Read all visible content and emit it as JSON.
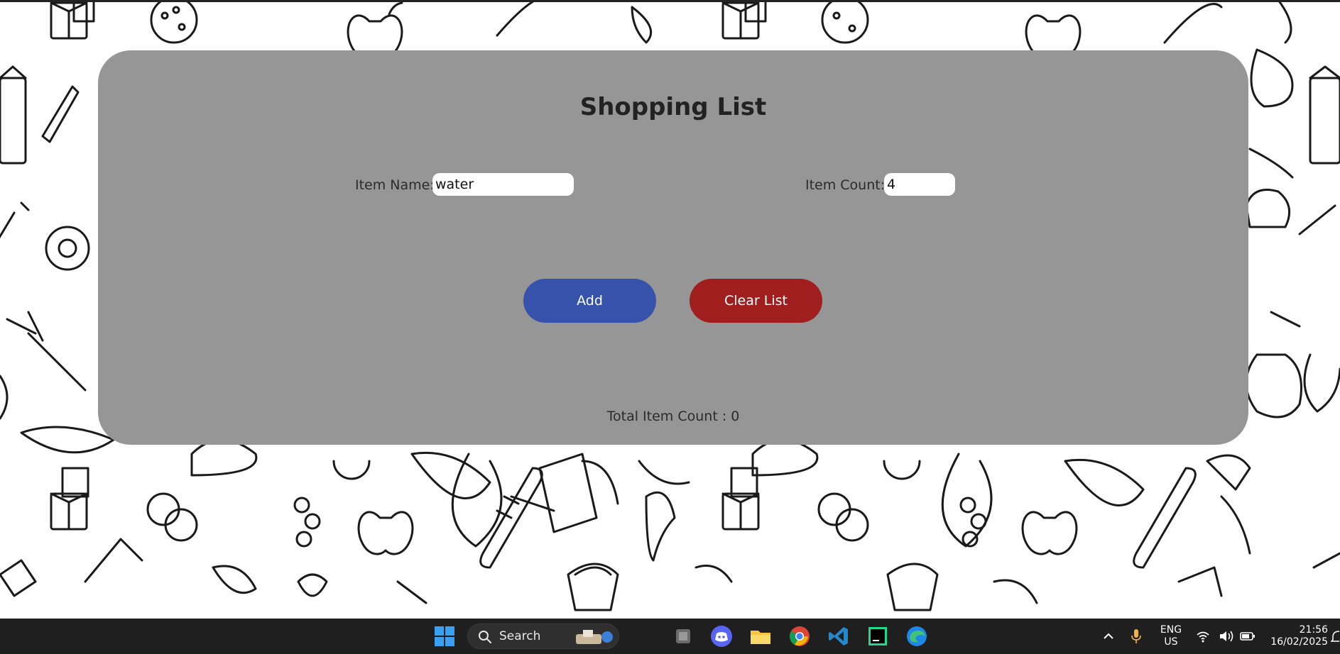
{
  "panel": {
    "title": "Shopping List",
    "item_name_label": "Item Name:",
    "item_name_value": "water",
    "item_count_label": "Item Count:",
    "item_count_value": "4",
    "add_label": "Add",
    "clear_label": "Clear List",
    "total_text": "Total Item Count : 0"
  },
  "colors": {
    "panel_bg": "#969696",
    "add_button": "#3752ab",
    "clear_button": "#a01e1e",
    "taskbar_bg": "#1f1f1f"
  },
  "taskbar": {
    "search_label": "Search",
    "lang_primary": "ENG",
    "lang_secondary": "US",
    "time": "21:56",
    "date": "16/02/2025",
    "apps": [
      "windows-start-icon",
      "files-icon",
      "discord-icon",
      "file-explorer-icon",
      "chrome-icon",
      "vscode-icon",
      "clion-icon",
      "edge-icon"
    ]
  }
}
